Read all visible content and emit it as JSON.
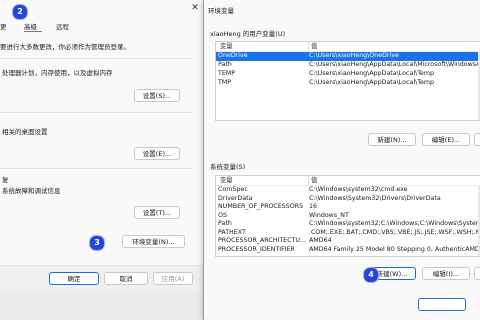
{
  "system_properties": {
    "close_glyph": "✕",
    "tabs": [
      "更",
      "高级",
      "远程"
    ],
    "hint": "要进行大多数更改，你必须作为管理员登录。",
    "performance": {
      "desc": "处理器计划，内存使用，以及虚拟内存",
      "settings_button": "设置(S)..."
    },
    "user_profiles": {
      "desc": "相关的桌面设置",
      "settings_button": "设置(E)..."
    },
    "startup_recovery": {
      "title": "复",
      "desc": "系统故障和调试信息",
      "settings_button": "设置(T)..."
    },
    "env_vars_button": "环境变量(N)...",
    "footer": {
      "ok": "确定",
      "cancel": "取消",
      "apply": "应用(A)"
    }
  },
  "annotations": [
    "2",
    "3",
    "4"
  ],
  "environment_variables": {
    "title": "环境变量",
    "user_group_label": "xiaoHeng 的用户变量(U)",
    "columns": {
      "variable": "变量",
      "value": "值"
    },
    "user_vars": [
      {
        "name": "OneDrive",
        "value": "C:\\Users\\xiaoHeng\\OneDrive",
        "selected": true
      },
      {
        "name": "Path",
        "value": "C:\\Users\\xiaoHeng\\AppData\\Local\\Microsoft\\WindowsApps;",
        "selected": false
      },
      {
        "name": "TEMP",
        "value": "C:\\Users\\xiaoHeng\\AppData\\Local\\Temp",
        "selected": false
      },
      {
        "name": "TMP",
        "value": "C:\\Users\\xiaoHeng\\AppData\\Local\\Temp",
        "selected": false
      }
    ],
    "user_buttons": {
      "new": "新建(N)...",
      "edit": "编辑(E)..."
    },
    "system_group_label": "系统变量(S)",
    "system_vars": [
      {
        "name": "ComSpec",
        "value": "C:\\Windows\\system32\\cmd.exe"
      },
      {
        "name": "DriverData",
        "value": "C:\\Windows\\System32\\Drivers\\DriverData"
      },
      {
        "name": "NUMBER_OF_PROCESSORS",
        "value": "16"
      },
      {
        "name": "OS",
        "value": "Windows_NT"
      },
      {
        "name": "Path",
        "value": "C:\\Windows\\system32;C:\\Windows;C:\\Windows\\System32"
      },
      {
        "name": "PATHEXT",
        "value": ".COM;.EXE;.BAT;.CMD;.VBS;.VBE;.JS;.JSE;.WSF;.WSH;.MSC"
      },
      {
        "name": "PROCESSOR_ARCHITECTU...",
        "value": "AMD64"
      },
      {
        "name": "PROCESSOR_IDENTIFIER",
        "value": "AMD64 Family 25 Model 80 Stepping 0, AuthenticAMD"
      }
    ],
    "system_buttons": {
      "new": "新建(W)...",
      "edit": "编辑(I)..."
    }
  },
  "colors": {
    "selection": "#1a73e8",
    "badge": "#2346d6",
    "primary_border": "#1b6fd0"
  }
}
